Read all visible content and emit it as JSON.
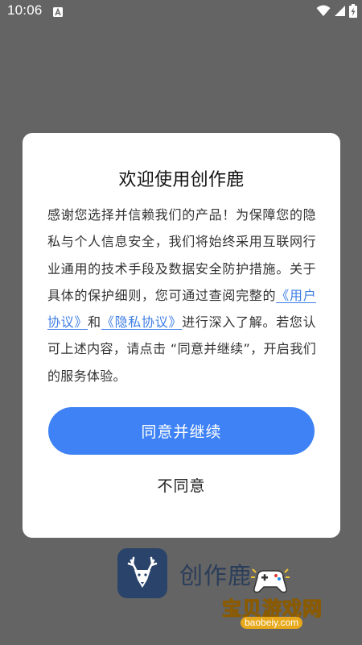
{
  "status_bar": {
    "time": "10:06",
    "icons": [
      "notification-a-icon",
      "wifi-icon",
      "signal-icon",
      "battery-charging-icon"
    ]
  },
  "dialog": {
    "title": "欢迎使用创作鹿",
    "body_part1": "感谢您选择并信赖我们的产品！为保障您的隐私与个人信息安全，我们将始终采用互联网行业通用的技术手段及数据安全防护措施。关于具体的保护细则，您可通过查阅完整的",
    "user_agreement_link": "《用户协议》",
    "body_and": "和",
    "privacy_agreement_link": "《隐私协议》",
    "body_part2": "进行深入了解。若您认可上述内容，请点击 “同意并继续”，开启我们的服务体验。",
    "agree_label": "同意并继续",
    "disagree_label": "不同意"
  },
  "app": {
    "name": "创作鹿",
    "logo_icon": "deer-logo-icon"
  },
  "watermark": {
    "text": "宝贝游戏网",
    "url": "baobeiy.com"
  },
  "colors": {
    "overlay": "#646464",
    "accent": "#3e82f5",
    "link": "#3e7ee6",
    "logo_bg": "#29436b"
  }
}
